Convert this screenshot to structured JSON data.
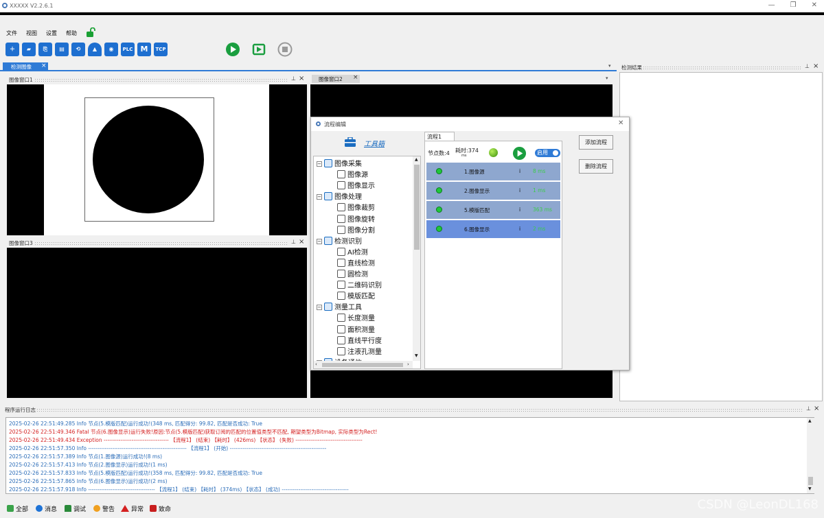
{
  "window": {
    "title": "XXXXX V2.2.6.1",
    "min": "—",
    "max": "❐",
    "close": "✕"
  },
  "menu": {
    "file": "文件",
    "view": "视图",
    "settings": "设置",
    "help": "帮助"
  },
  "toolbar": {
    "plc": "PLC",
    "m": "M",
    "tcp": "TCP"
  },
  "tabs": {
    "detect_image": "检测图像",
    "detect_result": "检测结果"
  },
  "panels": {
    "win1": "图像窗口1",
    "win2": "图像窗口2",
    "win3": "图像窗口3"
  },
  "dialog": {
    "title": "流程编辑",
    "toolbox": "工具箱",
    "flow_tab": "流程1",
    "node_count": "节点数:4",
    "time_label": "耗时:374",
    "time_unit": "ms",
    "enable": "启用",
    "add_flow": "添加流程",
    "delete_flow": "删除流程",
    "tree": [
      {
        "label": "图像采集",
        "level": 0
      },
      {
        "label": "图像源",
        "level": 1
      },
      {
        "label": "图像显示",
        "level": 1
      },
      {
        "label": "图像处理",
        "level": 0
      },
      {
        "label": "图像裁剪",
        "level": 1
      },
      {
        "label": "图像旋转",
        "level": 1
      },
      {
        "label": "图像分割",
        "level": 1
      },
      {
        "label": "检测识别",
        "level": 0
      },
      {
        "label": "AI检测",
        "level": 1
      },
      {
        "label": "直线检测",
        "level": 1
      },
      {
        "label": "圆检测",
        "level": 1
      },
      {
        "label": "二维码识别",
        "level": 1
      },
      {
        "label": "模版匹配",
        "level": 1
      },
      {
        "label": "测量工具",
        "level": 0
      },
      {
        "label": "长度测量",
        "level": 1
      },
      {
        "label": "面积测量",
        "level": 1
      },
      {
        "label": "直线平行度",
        "level": 1
      },
      {
        "label": "注液孔测量",
        "level": 1
      },
      {
        "label": "设备通信",
        "level": 0
      }
    ],
    "nodes": [
      {
        "name": "1.图像源",
        "info": "i",
        "ms": "8 ms"
      },
      {
        "name": "2.图像显示",
        "info": "i",
        "ms": "1 ms"
      },
      {
        "name": "5.模版匹配",
        "info": "i",
        "ms": "363 ms"
      },
      {
        "name": "6.图像显示",
        "info": "i",
        "ms": "2 ms"
      }
    ]
  },
  "log": {
    "title": "程序运行日志",
    "lines": [
      {
        "text": "2025-02-26 22:51:49.285    Info     节点(5.模版匹配)运行成功!(348 ms, 匹配得分: 99.82, 匹配是否成功: True",
        "color": "#2a6cb8"
      },
      {
        "text": "2025-02-26 22:51:49.346    Fatal    节点(6.图像显示)运行失败!原因:节点(5.模版匹配)获取订阅的匹配的位置值类型不匹配, 期望类型为Bitmap, 实际类型为Rect!",
        "color": "#d42020"
      },
      {
        "text": "2025-02-26 22:51:49.434    Exception    -----------------------------------    【流程1】 (结束)    【耗时】 (426ms)    【状态】 (失败)    ------------------------------------",
        "color": "#d42020"
      },
      {
        "text": "2025-02-26 22:51:57.350    Info     -----------------------------------------------------    【流程1】 (开始)    ----------------------------------------------------",
        "color": "#2a6cb8"
      },
      {
        "text": "2025-02-26 22:51:57.389    Info     节点(1.图像源)运行成功!(8 ms)",
        "color": "#2a6cb8"
      },
      {
        "text": "2025-02-26 22:51:57.413    Info     节点(2.图像显示)运行成功!(1 ms)",
        "color": "#2a6cb8"
      },
      {
        "text": "2025-02-26 22:51:57.833    Info     节点(5.模版匹配)运行成功!(358 ms, 匹配得分: 99.82, 匹配是否成功: True",
        "color": "#2a6cb8"
      },
      {
        "text": "2025-02-26 22:51:57.865    Info     节点(6.图像显示)运行成功!(2 ms)",
        "color": "#2a6cb8"
      },
      {
        "text": "2025-02-26 22:51:57.918    Info     ------------------------------------    【流程1】 (结束)    【耗时】 (374ms)    【状态】 (成功)    ------------------------------------",
        "color": "#2a6cb8"
      }
    ]
  },
  "status": {
    "all": "全部",
    "message": "消息",
    "debug": "调试",
    "warning": "警告",
    "exception": "异常",
    "fatal": "致命"
  },
  "watermark": "CSDN @LeonDL168"
}
